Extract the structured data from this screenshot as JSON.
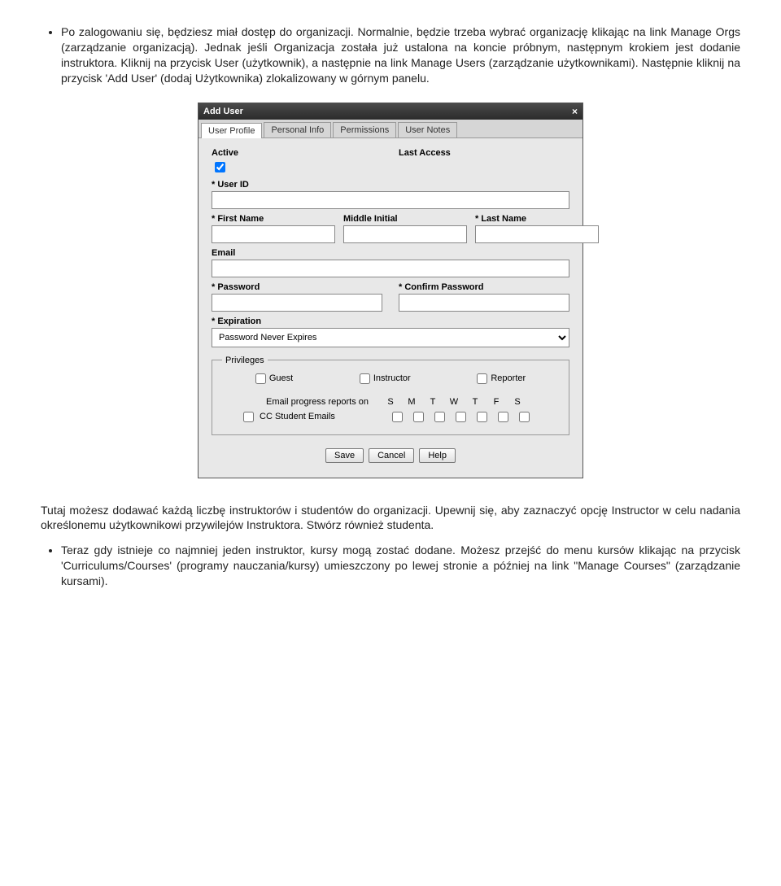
{
  "bullet1": {
    "p1": "Po zalogowaniu się, będziesz miał dostęp do organizacji. Normalnie, będzie trzeba wybrać organizację klikając na link Manage Orgs (zarządzanie organizacją). Jednak jeśli Organizacja została już ustalona na koncie próbnym, następnym krokiem jest dodanie instruktora. Kliknij na przycisk User (użytkownik), a następnie na link Manage Users (zarządzanie użytkownikami). Następnie kliknij na przycisk 'Add User' (dodaj Użytkownika) zlokalizowany w górnym panelu."
  },
  "dialog": {
    "title": "Add User",
    "tabs": [
      "User Profile",
      "Personal Info",
      "Permissions",
      "User Notes"
    ],
    "labels": {
      "active": "Active",
      "lastAccess": "Last Access",
      "userId": "* User ID",
      "firstName": "* First Name",
      "middleInitial": "Middle Initial",
      "lastName": "* Last Name",
      "email": "Email",
      "password": "* Password",
      "confirmPassword": "* Confirm Password",
      "expiration": "* Expiration",
      "expirationValue": "Password Never Expires",
      "privilegesLegend": "Privileges",
      "guest": "Guest",
      "instructor": "Instructor",
      "reporter": "Reporter",
      "emailReports": "Email progress reports on",
      "ccStudent": "CC Student Emails",
      "days": [
        "S",
        "M",
        "T",
        "W",
        "T",
        "F",
        "S"
      ]
    },
    "buttons": {
      "save": "Save",
      "cancel": "Cancel",
      "help": "Help"
    }
  },
  "para2": "Tutaj możesz dodawać każdą liczbę instruktorów i studentów do organizacji. Upewnij się, aby zaznaczyć opcję Instructor w celu nadania określonemu użytkownikowi przywilejów Instruktora. Stwórz również studenta.",
  "bullet2": "Teraz gdy istnieje co najmniej jeden instruktor, kursy mogą zostać dodane. Możesz przejść do menu kursów klikając na przycisk 'Curriculums/Courses' (programy nauczania/kursy) umieszczony po lewej stronie a później na link \"Manage Courses\" (zarządzanie kursami)."
}
